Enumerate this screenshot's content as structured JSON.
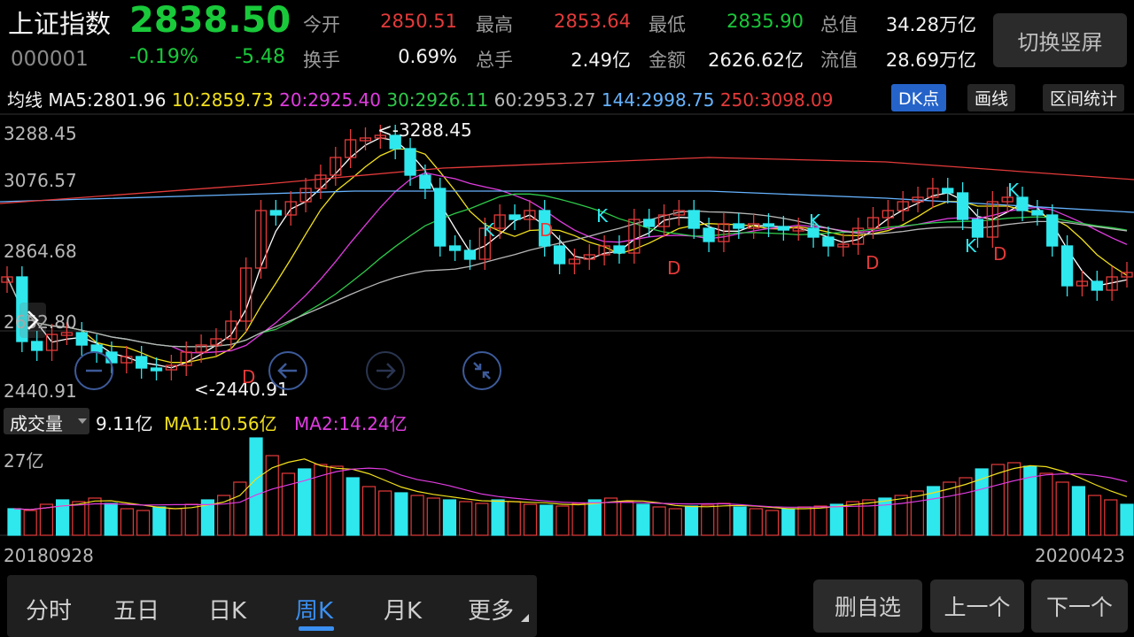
{
  "quote": {
    "name": "上证指数",
    "code": "000001",
    "price": "2838.50",
    "change_pct": "-0.19%",
    "change": "-5.48",
    "open_label": "今开",
    "open": "2850.51",
    "high_label": "最高",
    "high": "2853.64",
    "low_label": "最低",
    "low": "2835.90",
    "mktcap_label": "总值",
    "mktcap": "34.28万亿",
    "turnover_label": "换手",
    "turnover": "0.69%",
    "volume_label": "总手",
    "volume": "2.49亿",
    "amount_label": "金额",
    "amount": "2626.62亿",
    "float_label": "流值",
    "float_cap": "28.69万亿",
    "switch_label": "切换竖屏"
  },
  "ma_bar": {
    "label": "均线",
    "ma5": "MA5:2801.96",
    "ma10": "10:2859.73",
    "ma20": "20:2925.40",
    "ma30": "30:2926.11",
    "ma60": "60:2953.27",
    "ma144": "144:2998.75",
    "ma250": "250:3098.09",
    "btn_dk": "DK点",
    "btn_draw": "画线",
    "btn_range": "区间统计"
  },
  "price_chart": {
    "y_labels": [
      "3288.45",
      "3076.57",
      "2864.68",
      "2652.80",
      "2440.91"
    ],
    "high_marker": "<-3288.45",
    "low_marker": "<-2440.91",
    "signal_k": "K",
    "signal_d": "D"
  },
  "volume": {
    "selector": "成交量",
    "current": "9.11亿",
    "ma1": "MA1:10.56亿",
    "ma2": "MA2:14.24亿",
    "y_label": "27亿"
  },
  "dates": {
    "start": "20180928",
    "end": "20200423"
  },
  "tabs": [
    "分时",
    "五日",
    "日K",
    "周K",
    "月K",
    "更多"
  ],
  "active_tab": "周K",
  "actions": {
    "delete_watch": "删自选",
    "prev": "上一个",
    "next": "下一个"
  },
  "colors": {
    "up": "#e43a3a",
    "down": "#2ee8ee",
    "ma5": "#ffffff",
    "ma10": "#f2e01c",
    "ma20": "#e03ce0",
    "ma30": "#2ec94a",
    "ma60": "#b8b8b8",
    "ma144": "#66b3ff",
    "ma250": "#e43a3a"
  }
}
